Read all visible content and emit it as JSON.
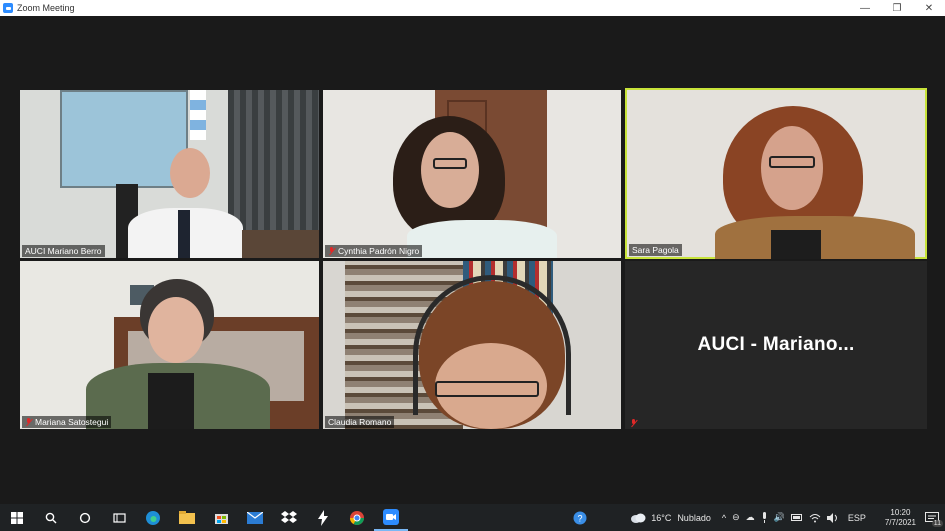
{
  "window": {
    "title": "Zoom Meeting",
    "controls": {
      "minimize": "—",
      "restore": "❐",
      "close": "✕"
    }
  },
  "participants": [
    {
      "name": "AUCI Mariano Berro",
      "muted": false,
      "active": false
    },
    {
      "name": "Cynthia Padrón Nigro",
      "muted": true,
      "active": false
    },
    {
      "name": "Sara Pagola",
      "muted": false,
      "active": true
    },
    {
      "name": "Mariana Satostegui",
      "muted": true,
      "active": false
    },
    {
      "name": "Claudia Romano",
      "muted": false,
      "active": false
    },
    {
      "name": "AUCI  -  Mariano...",
      "muted": true,
      "active": false,
      "video_off": true
    }
  ],
  "taskbar": {
    "apps": [
      "windows-start",
      "search",
      "cortana",
      "task-view",
      "edge",
      "file-explorer",
      "store",
      "mail",
      "dropbox",
      "app-s",
      "chrome",
      "zoom"
    ],
    "weather": {
      "temp": "16°C",
      "condition": "Nublado"
    },
    "language": "ESP",
    "time": "10:20",
    "date": "7/7/2021",
    "notifications": "11"
  },
  "colors": {
    "active_speaker": "#c8e33a",
    "background": "#1a1a1a",
    "taskbar": "#1f2224",
    "mute_red": "#e02828"
  }
}
